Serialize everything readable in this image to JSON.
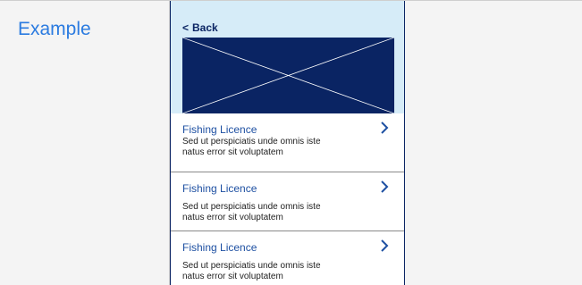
{
  "label": {
    "text": "Example"
  },
  "phone": {
    "back_label": "Back",
    "hero_image_icon": "image-placeholder-icon",
    "items": [
      {
        "title": "Fishing Licence",
        "description_line1": "Sed ut perspiciatis unde omnis iste",
        "description_line2": "natus error sit voluptatem"
      },
      {
        "title": "Fishing Licence",
        "description_line1": "Sed ut perspiciatis unde omnis iste",
        "description_line2": "natus error sit voluptatem"
      },
      {
        "title": "Fishing Licence",
        "description_line1": "Sed ut perspiciatis unde omnis iste",
        "description_line2": "natus error sit voluptatem"
      }
    ]
  },
  "colors": {
    "label_blue": "#2b7be0",
    "navy": "#0a2463",
    "header_bg": "#d6ecf8",
    "link_blue": "#1e50a2"
  }
}
